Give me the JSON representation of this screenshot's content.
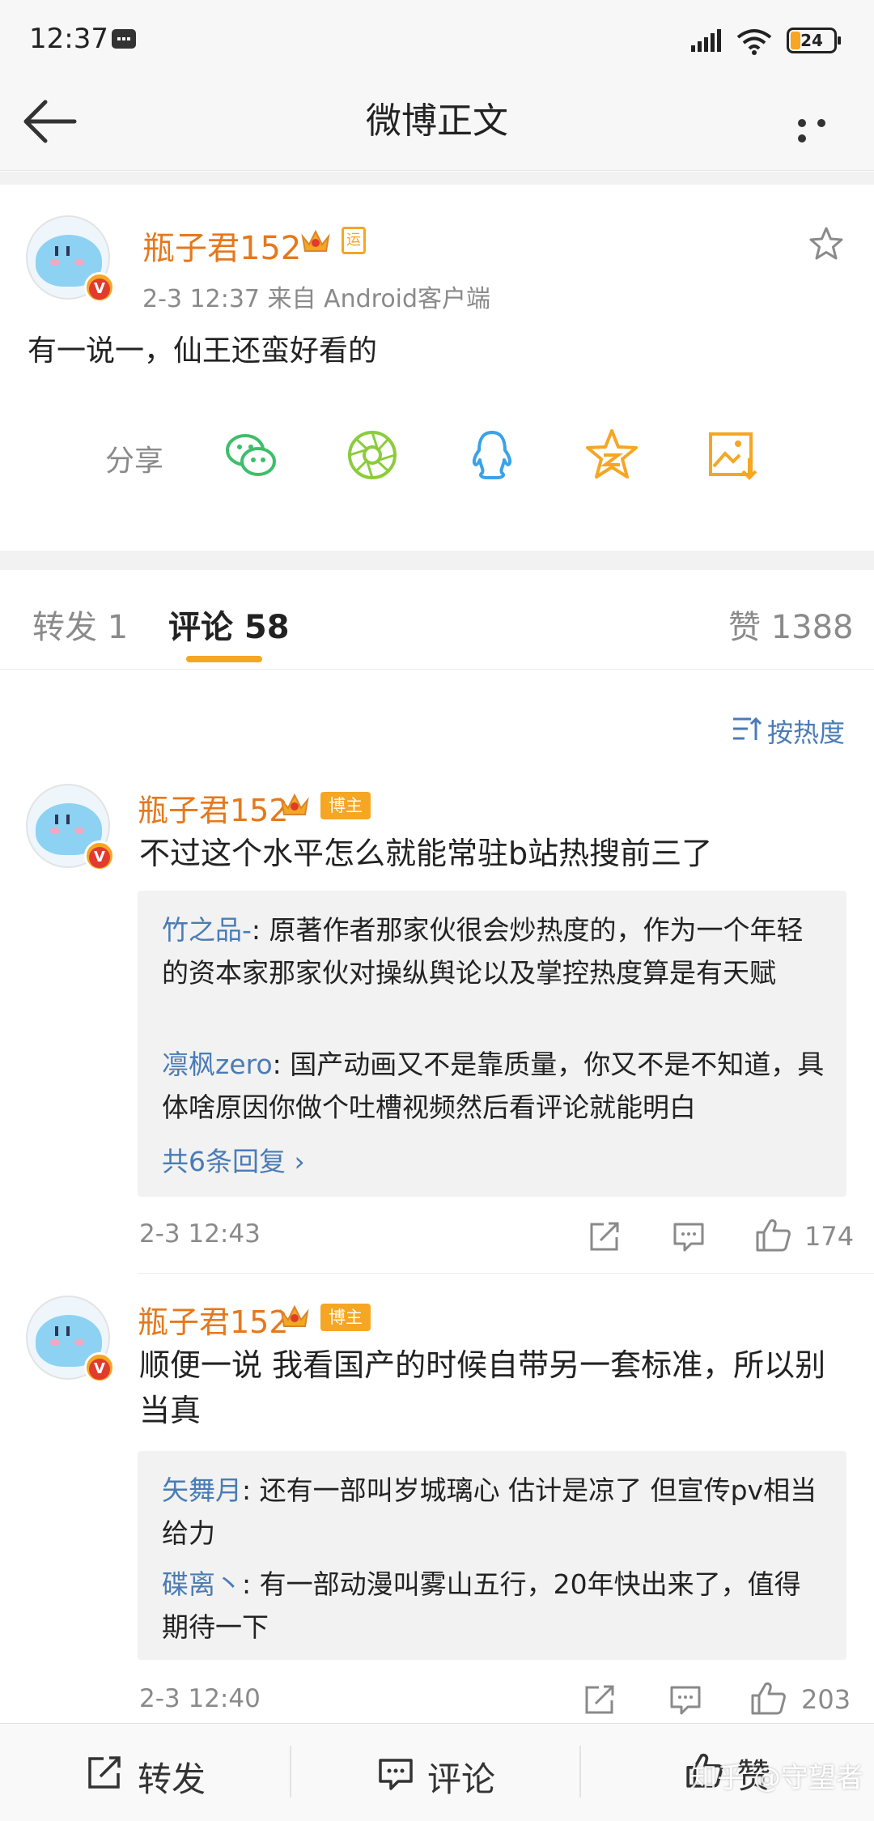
{
  "status_bar": {
    "time": "12:37",
    "battery": "24"
  },
  "nav": {
    "title": "微博正文"
  },
  "post": {
    "username": "瓶子君152",
    "vip_tag": "运",
    "meta": "2-3 12:37   来自 Android客户端",
    "text": "有一说一，仙王还蛮好看的",
    "share_label": "分享",
    "share_icons": [
      "wechat-icon",
      "moments-icon",
      "qq-icon",
      "qzone-icon",
      "save-image-icon"
    ]
  },
  "tabs": {
    "repost": "转发 1",
    "comment": "评论 58",
    "like": "赞 1388"
  },
  "sort_label": "按热度",
  "comments": [
    {
      "username": "瓶子君152",
      "badge": "博主",
      "text": "不过这个水平怎么就能常驻b站热搜前三了",
      "replies": [
        {
          "name": "竹之品-",
          "text": ": 原著作者那家伙很会炒热度的，作为一个年轻的资本家那家伙对操纵舆论以及掌控热度算是有天赋"
        },
        {
          "name": "凛枫zero",
          "text": ": 国产动画又不是靠质量，你又不是不知道，具体啥原因你做个吐槽视频然后看评论就能明白"
        }
      ],
      "more_replies": "共6条回复 ›",
      "time": "2-3 12:43",
      "likes": "174"
    },
    {
      "username": "瓶子君152",
      "badge": "博主",
      "text": "顺便一说 我看国产的时候自带另一套标准，所以别当真",
      "replies": [
        {
          "name": "矢舞月",
          "text": ": 还有一部叫岁城璃心  估计是凉了  但宣传pv相当给力"
        },
        {
          "name": "碟离丶",
          "text": ": 有一部动漫叫雾山五行，20年快出来了，值得期待一下"
        }
      ],
      "time": "2-3 12:40",
      "likes": "203"
    }
  ],
  "bottom_bar": {
    "repost": "转发",
    "comment": "评论",
    "like": "赞"
  },
  "watermark": "知乎 @守望者",
  "colors": {
    "accent": "#f5a623",
    "username": "#e5781b",
    "link": "#4a7cb5"
  }
}
